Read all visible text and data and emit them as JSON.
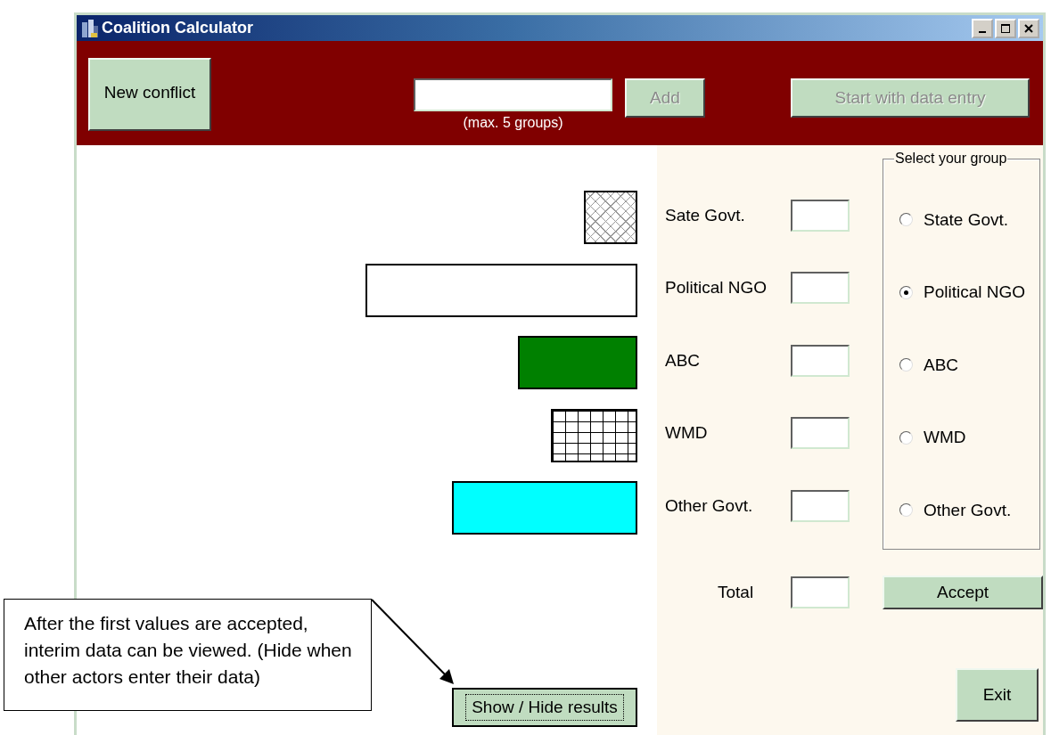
{
  "window": {
    "title": "Coalition Calculator"
  },
  "toolbar": {
    "new_button": {
      "label": "New conflict",
      "disabled": false
    },
    "group_hint": "(max. 5 groups)",
    "add_button": {
      "label": "Add",
      "disabled": true
    },
    "start_button": {
      "label": "Start with data entry",
      "disabled": true
    }
  },
  "bars": [
    {
      "kind": "crosshatch"
    },
    {
      "kind": "empty"
    },
    {
      "kind": "solid",
      "color": "#008000"
    },
    {
      "kind": "grid"
    },
    {
      "kind": "solid",
      "color": "#00ffff"
    }
  ],
  "entries": [
    {
      "label": "Sate Govt."
    },
    {
      "label": "Political NGO"
    },
    {
      "label": "ABC"
    },
    {
      "label": "WMD"
    },
    {
      "label": "Other Govt."
    }
  ],
  "group_select": {
    "title": "Select your group",
    "options": [
      {
        "label": "State Govt.",
        "selected": false
      },
      {
        "label": "Political NGO",
        "selected": true
      },
      {
        "label": "ABC",
        "selected": false
      },
      {
        "label": "WMD",
        "selected": false
      },
      {
        "label": "Other Govt.",
        "selected": false
      }
    ]
  },
  "total": {
    "label": "Total"
  },
  "accept_button": "Accept",
  "exit_button": "Exit",
  "results_button": "Show / Hide results",
  "callout": {
    "text": "After the first values are accepted, interim data can be viewed. (Hide when other actors enter their data)"
  }
}
